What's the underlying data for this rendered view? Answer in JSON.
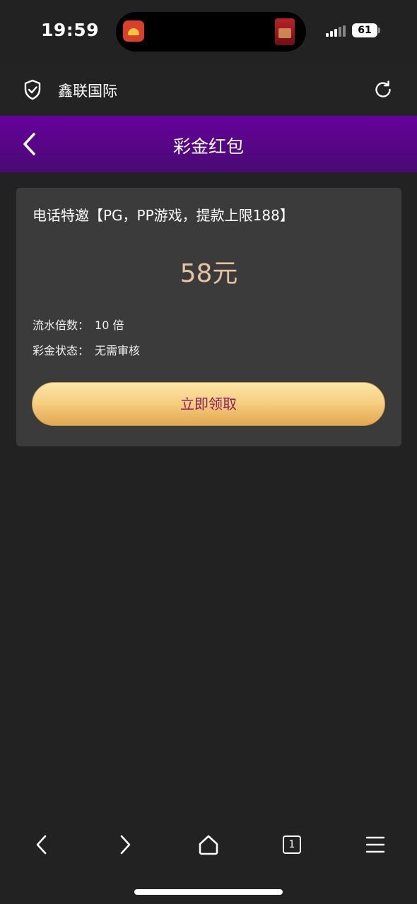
{
  "status_bar": {
    "time": "19:59",
    "battery_level": "61"
  },
  "browser": {
    "site_title": "鑫联国际",
    "tabs_count": "1"
  },
  "header": {
    "title": "彩金红包"
  },
  "bonus": {
    "title": "电话特邀【PG，PP游戏，提款上限188】",
    "amount": "58元",
    "wager_label": "流水倍数：",
    "wager_value": "10 倍",
    "status_label": "彩金状态：",
    "status_value": "无需审核",
    "claim_label": "立即领取"
  },
  "colors": {
    "header_gradient_start": "#65019c",
    "header_gradient_end": "#4a0a72",
    "amount_color": "#e6c3a0",
    "button_gold": "#f7cf84",
    "button_text": "#8a1f5a",
    "background": "#222222",
    "card_background": "#3b3b3b"
  },
  "icons": {
    "shield": "shield-check-icon",
    "reload": "reload-icon",
    "back": "chevron-left-icon",
    "nav_back": "browser-back-icon",
    "nav_forward": "browser-forward-icon",
    "home": "home-icon",
    "tabs": "tabs-icon",
    "menu": "menu-icon"
  }
}
